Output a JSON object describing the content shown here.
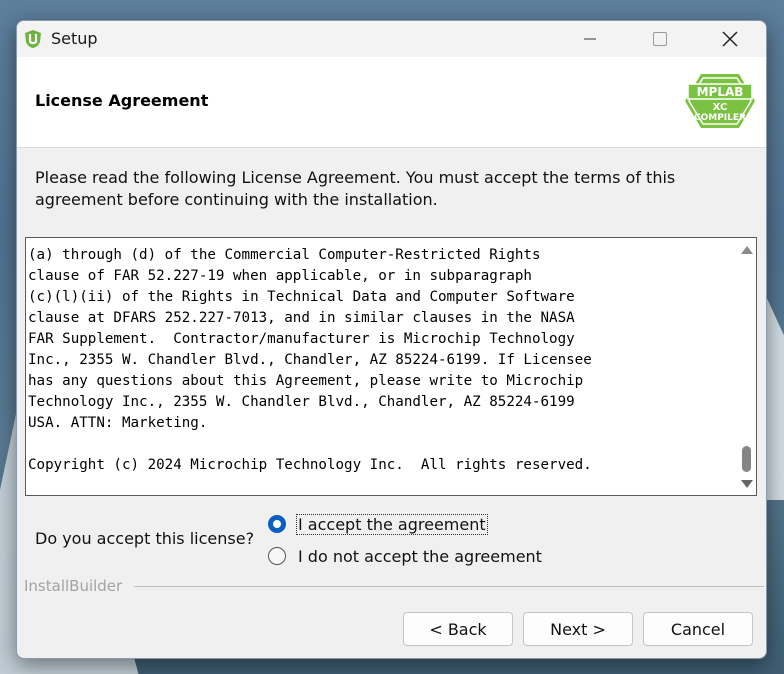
{
  "window": {
    "title": "Setup"
  },
  "header": {
    "title": "License Agreement",
    "logo": {
      "line1": "MPLAB",
      "line2": "XC",
      "line3": "COMPILER",
      "color": "#7cc242"
    }
  },
  "intro": {
    "text": "Please read the following License Agreement. You must accept the terms of this agreement before continuing with the installation."
  },
  "license": {
    "lines": [
      "(a) through (d) of the Commercial Computer-Restricted Rights",
      "clause of FAR 52.227-19 when applicable, or in subparagraph",
      "(c)(l)(ii) of the Rights in Technical Data and Computer Software",
      "clause at DFARS 252.227-7013, and in similar clauses in the NASA",
      "FAR Supplement.  Contractor/manufacturer is Microchip Technology",
      "Inc., 2355 W. Chandler Blvd., Chandler, AZ 85224-6199. If Licensee",
      "has any questions about this Agreement, please write to Microchip",
      "Technology Inc., 2355 W. Chandler Blvd., Chandler, AZ 85224-6199",
      "USA. ATTN: Marketing.",
      "",
      "Copyright (c) 2024 Microchip Technology Inc.  All rights reserved."
    ],
    "scroll_position": 0.97
  },
  "choice": {
    "question": "Do you accept this license?",
    "accept_label": "I accept the agreement",
    "decline_label": "I do not accept the agreement",
    "selected": "accept"
  },
  "brand": {
    "text": "InstallBuilder"
  },
  "buttons": {
    "back": "< Back",
    "next": "Next >",
    "cancel": "Cancel"
  },
  "colors": {
    "accent": "#0a5fc2",
    "window_bg": "#f0f0f0"
  }
}
